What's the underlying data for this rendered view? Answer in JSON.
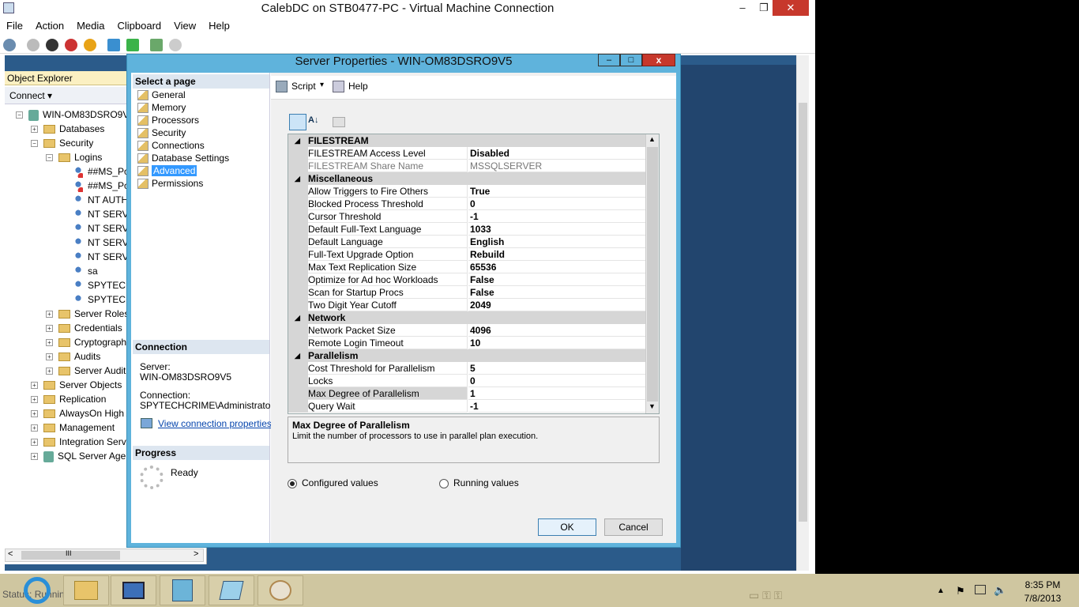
{
  "vm_window": {
    "title": "CalebDC on STB0477-PC - Virtual Machine Connection",
    "minimize": "–",
    "maximize": "❐",
    "close": "✕",
    "menu": [
      "File",
      "Action",
      "Media",
      "Clipboard",
      "View",
      "Help"
    ]
  },
  "object_explorer": {
    "title": "Object Explorer",
    "connect_label": "Connect ▾",
    "tree": [
      {
        "label": "WIN-OM83DSRO9V5",
        "level": 0,
        "exp": "−",
        "icon": "server"
      },
      {
        "label": "Databases",
        "level": 1,
        "exp": "+",
        "icon": "folder"
      },
      {
        "label": "Security",
        "level": 1,
        "exp": "−",
        "icon": "folder"
      },
      {
        "label": "Logins",
        "level": 2,
        "exp": "−",
        "icon": "folder"
      },
      {
        "label": "##MS_Pol",
        "level": 3,
        "exp": "",
        "icon": "user-red"
      },
      {
        "label": "##MS_Pol",
        "level": 3,
        "exp": "",
        "icon": "user-red"
      },
      {
        "label": "NT AUTH",
        "level": 3,
        "exp": "",
        "icon": "user"
      },
      {
        "label": "NT SERVI",
        "level": 3,
        "exp": "",
        "icon": "user"
      },
      {
        "label": "NT SERVI",
        "level": 3,
        "exp": "",
        "icon": "user"
      },
      {
        "label": "NT SERVI",
        "level": 3,
        "exp": "",
        "icon": "user"
      },
      {
        "label": "NT SERVI",
        "level": 3,
        "exp": "",
        "icon": "user"
      },
      {
        "label": "sa",
        "level": 3,
        "exp": "",
        "icon": "user"
      },
      {
        "label": "SPYTECH",
        "level": 3,
        "exp": "",
        "icon": "user"
      },
      {
        "label": "SPYTECH",
        "level": 3,
        "exp": "",
        "icon": "user"
      },
      {
        "label": "Server Roles",
        "level": 2,
        "exp": "+",
        "icon": "folder"
      },
      {
        "label": "Credentials",
        "level": 2,
        "exp": "+",
        "icon": "folder"
      },
      {
        "label": "Cryptographi",
        "level": 2,
        "exp": "+",
        "icon": "folder"
      },
      {
        "label": "Audits",
        "level": 2,
        "exp": "+",
        "icon": "folder"
      },
      {
        "label": "Server Audit S",
        "level": 2,
        "exp": "+",
        "icon": "folder"
      },
      {
        "label": "Server Objects",
        "level": 1,
        "exp": "+",
        "icon": "folder"
      },
      {
        "label": "Replication",
        "level": 1,
        "exp": "+",
        "icon": "folder"
      },
      {
        "label": "AlwaysOn High A",
        "level": 1,
        "exp": "+",
        "icon": "folder"
      },
      {
        "label": "Management",
        "level": 1,
        "exp": "+",
        "icon": "folder"
      },
      {
        "label": "Integration Servic",
        "level": 1,
        "exp": "+",
        "icon": "folder"
      },
      {
        "label": "SQL Server Agent",
        "level": 1,
        "exp": "+",
        "icon": "agent"
      }
    ],
    "hscroll_left": "<",
    "hscroll_right": ">",
    "hscroll_grip": "III"
  },
  "dialog": {
    "title": "Server Properties - WIN-OM83DSRO9V5",
    "select_page_header": "Select a page",
    "pages": [
      "General",
      "Memory",
      "Processors",
      "Security",
      "Connections",
      "Database Settings",
      "Advanced",
      "Permissions"
    ],
    "selected_page": "Advanced",
    "connection": {
      "header": "Connection",
      "server_label": "Server:",
      "server_value": "WIN-OM83DSRO9V5",
      "connection_label": "Connection:",
      "connection_value": "SPYTECHCRIME\\Administrator",
      "link": "View connection properties"
    },
    "progress": {
      "header": "Progress",
      "status": "Ready"
    },
    "toolbar": {
      "script": "Script",
      "help": "Help"
    },
    "grid": [
      {
        "type": "cat",
        "name": "FILESTREAM"
      },
      {
        "type": "prop",
        "name": "FILESTREAM Access Level",
        "value": "Disabled"
      },
      {
        "type": "prop",
        "name": "FILESTREAM Share Name",
        "value": "MSSQLSERVER",
        "dim": true
      },
      {
        "type": "cat",
        "name": "Miscellaneous"
      },
      {
        "type": "prop",
        "name": "Allow Triggers to Fire Others",
        "value": "True"
      },
      {
        "type": "prop",
        "name": "Blocked Process Threshold",
        "value": "0"
      },
      {
        "type": "prop",
        "name": "Cursor Threshold",
        "value": "-1"
      },
      {
        "type": "prop",
        "name": "Default Full-Text Language",
        "value": "1033"
      },
      {
        "type": "prop",
        "name": "Default Language",
        "value": "English"
      },
      {
        "type": "prop",
        "name": "Full-Text Upgrade Option",
        "value": "Rebuild"
      },
      {
        "type": "prop",
        "name": "Max Text Replication Size",
        "value": "65536"
      },
      {
        "type": "prop",
        "name": "Optimize for Ad hoc Workloads",
        "value": "False"
      },
      {
        "type": "prop",
        "name": "Scan for Startup Procs",
        "value": "False"
      },
      {
        "type": "prop",
        "name": "Two Digit Year Cutoff",
        "value": "2049"
      },
      {
        "type": "cat",
        "name": "Network"
      },
      {
        "type": "prop",
        "name": "Network Packet Size",
        "value": "4096"
      },
      {
        "type": "prop",
        "name": "Remote Login Timeout",
        "value": "10"
      },
      {
        "type": "cat",
        "name": "Parallelism"
      },
      {
        "type": "prop",
        "name": "Cost Threshold for Parallelism",
        "value": "5"
      },
      {
        "type": "prop",
        "name": "Locks",
        "value": "0"
      },
      {
        "type": "prop",
        "name": "Max Degree of Parallelism",
        "value": "1",
        "selected": true
      },
      {
        "type": "prop",
        "name": "Query Wait",
        "value": "-1"
      }
    ],
    "description": {
      "title": "Max Degree of Parallelism",
      "text": "Limit the number of processors to use in parallel plan execution."
    },
    "radio_configured": "Configured values",
    "radio_running": "Running values",
    "radio_selected": "Configured values",
    "ok": "OK",
    "cancel": "Cancel"
  },
  "taskbar": {
    "status_text": "Status: Running",
    "time": "8:35 PM",
    "date": "7/8/2013"
  }
}
